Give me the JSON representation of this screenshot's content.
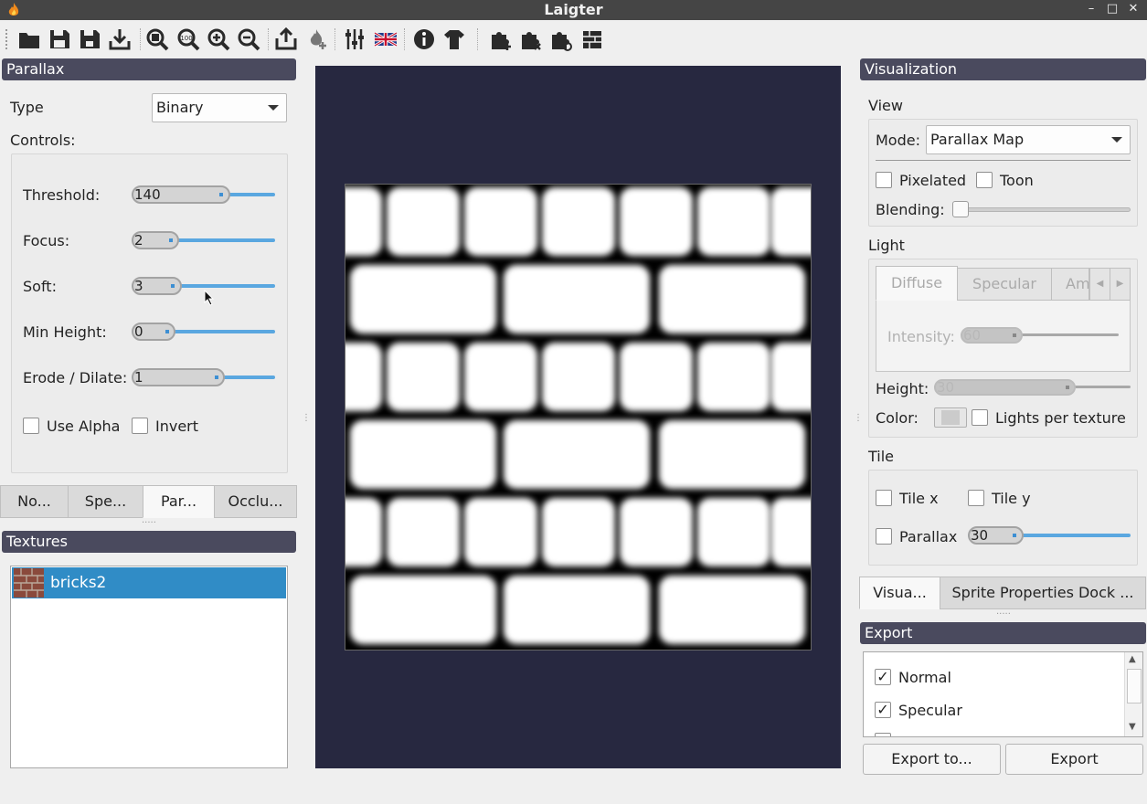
{
  "window": {
    "title": "Laigter"
  },
  "toolbar": {
    "icons": [
      "open-folder-icon",
      "save-icon",
      "save-all-icon",
      "import-icon",
      "zoom-fit-icon",
      "zoom-100-icon",
      "zoom-in-icon",
      "zoom-out-icon",
      "export-icon",
      "plugin-icon",
      "presets-icon",
      "language-flag-icon",
      "about-icon",
      "tshirt-icon",
      "add-light-icon",
      "remove-light-icon",
      "light-settings-icon",
      "tile-icon"
    ]
  },
  "parallax": {
    "title": "Parallax",
    "type_label": "Type",
    "type_value": "Binary",
    "controls_label": "Controls:",
    "threshold": {
      "label": "Threshold:",
      "value": "140"
    },
    "focus": {
      "label": "Focus:",
      "value": "2"
    },
    "soft": {
      "label": "Soft:",
      "value": "3"
    },
    "min_height": {
      "label": "Min Height:",
      "value": "0"
    },
    "erode": {
      "label": "Erode / Dilate:",
      "value": "1"
    },
    "use_alpha": "Use Alpha",
    "invert": "Invert"
  },
  "map_tabs": [
    "No...",
    "Spe...",
    "Par...",
    "Occlu..."
  ],
  "textures": {
    "title": "Textures",
    "items": [
      "bricks2"
    ]
  },
  "visualization": {
    "title": "Visualization",
    "view_label": "View",
    "mode_label": "Mode:",
    "mode_value": "Parallax Map",
    "pixelated": "Pixelated",
    "toon": "Toon",
    "blending_label": "Blending:",
    "light_label": "Light",
    "light_tabs": [
      "Diffuse",
      "Specular",
      "Am"
    ],
    "intensity_label": "Intensity:",
    "intensity_value": "60",
    "height_label": "Height:",
    "height_value": "30",
    "color_label": "Color:",
    "lights_per_texture": "Lights per texture",
    "tile_label": "Tile",
    "tile_x": "Tile x",
    "tile_y": "Tile y",
    "parallax_label": "Parallax",
    "parallax_value": "30"
  },
  "dock_tabs": [
    "Visua...",
    "Sprite Properties Dock ..."
  ],
  "export": {
    "title": "Export",
    "items": [
      "Normal",
      "Specular"
    ],
    "export_to_label": "Export to...",
    "export_label": "Export"
  },
  "colors": {
    "accent": "#5aa7e0",
    "selection": "#308cc6",
    "dock_title": "#4a4a5e",
    "canvas_bg": "#272840"
  }
}
